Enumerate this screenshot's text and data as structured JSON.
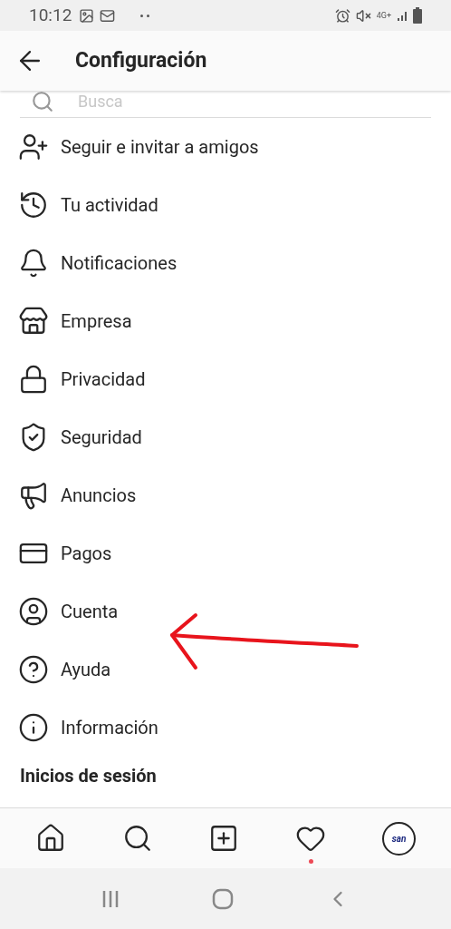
{
  "status_bar": {
    "time": "10:12",
    "network": "4G+"
  },
  "header": {
    "title": "Configuración"
  },
  "search": {
    "placeholder": "Busca"
  },
  "items": [
    {
      "label": "Seguir e invitar a amigos"
    },
    {
      "label": "Tu actividad"
    },
    {
      "label": "Notificaciones"
    },
    {
      "label": "Empresa"
    },
    {
      "label": "Privacidad"
    },
    {
      "label": "Seguridad"
    },
    {
      "label": "Anuncios"
    },
    {
      "label": "Pagos"
    },
    {
      "label": "Cuenta"
    },
    {
      "label": "Ayuda"
    },
    {
      "label": "Información"
    }
  ],
  "section_heading": "Inicios de sesión",
  "annotation": {
    "kind": "arrow",
    "color": "#e8141c"
  },
  "bottom_nav": {
    "activity_notification": true,
    "avatar_text": "san"
  }
}
